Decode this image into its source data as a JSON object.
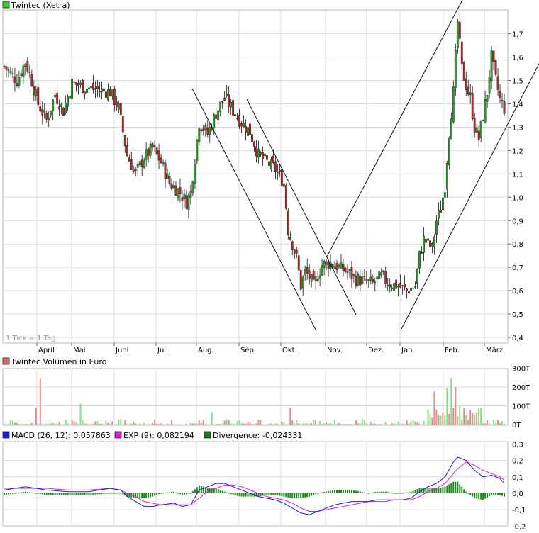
{
  "colors": {
    "up": "#2e9e2e",
    "down": "#b52a2a",
    "grid": "#dcdcdc",
    "axis": "#999999",
    "frame": "#bbbbbb",
    "macd": "#1b1bd6",
    "exp": "#d41fd4",
    "divergence": "#1a8a1a",
    "volume_up": "#84e084",
    "volume_down": "#e08a8a",
    "legend_price": "#36c836",
    "legend_volume": "#d46a6a",
    "legend_macd": "#1b1bd6",
    "legend_exp": "#d41fd4",
    "legend_div": "#1a7a1a"
  },
  "months": [
    "April",
    "Mai",
    "Juni",
    "Juli",
    "Aug.",
    "Sep.",
    "Okt.",
    "Nov.",
    "Dez.",
    "Jan.",
    "Feb.",
    "März"
  ],
  "price_panel": {
    "legend": "Twintec (Xetra)",
    "note": "1 Tick = 1 Tag",
    "y_ticks": [
      "0,4",
      "0,5",
      "0,6",
      "0,7",
      "0,8",
      "0,9",
      "1,0",
      "1,1",
      "1,2",
      "1,3",
      "1,4",
      "1,5",
      "1,6",
      "1,7"
    ]
  },
  "volume_panel": {
    "legend": "Twintec Volumen in Euro",
    "y_ticks": [
      "0T",
      "100T",
      "200T",
      "300T"
    ]
  },
  "macd_panel": {
    "legend_macd": "MACD (26, 12): 0,057863",
    "legend_exp": "EXP (9): 0,082194",
    "legend_div": "Divergence: -0,024331",
    "y_ticks": [
      "-0,2",
      "-0,1",
      "0,0",
      "0,1",
      "0,2",
      "0,3"
    ]
  },
  "chart_data": [
    {
      "type": "candlestick",
      "title": "Twintec (Xetra)",
      "x_unit": "trading days (1 Tick = 1 Tag)",
      "ylim": [
        0.4,
        1.8
      ],
      "grid": true,
      "trend_lines": [
        {
          "from": [
            "Juli end",
            1.46
          ],
          "to": [
            "Okt. end",
            0.43
          ]
        },
        {
          "from": [
            "Aug. end",
            1.42
          ],
          "to": [
            "Nov. end",
            0.5
          ]
        },
        {
          "from": [
            "Nov. start",
            0.73
          ],
          "to": [
            "Feb. end",
            1.82
          ]
        },
        {
          "from": [
            "Dez. end",
            0.44
          ],
          "to": [
            "März end",
            1.56
          ]
        }
      ],
      "close_path": [
        [
          0,
          1.56
        ],
        [
          6,
          1.5
        ],
        [
          10,
          1.58
        ],
        [
          12,
          1.53
        ],
        [
          16,
          1.4
        ],
        [
          20,
          1.33
        ],
        [
          24,
          1.44
        ],
        [
          28,
          1.37
        ],
        [
          32,
          1.49
        ],
        [
          38,
          1.47
        ],
        [
          44,
          1.46
        ],
        [
          50,
          1.45
        ],
        [
          54,
          1.38
        ],
        [
          58,
          1.18
        ],
        [
          62,
          1.1
        ],
        [
          66,
          1.17
        ],
        [
          70,
          1.21
        ],
        [
          74,
          1.15
        ],
        [
          78,
          1.06
        ],
        [
          82,
          1.03
        ],
        [
          86,
          0.98
        ],
        [
          88,
          1.02
        ],
        [
          92,
          1.32
        ],
        [
          96,
          1.27
        ],
        [
          100,
          1.36
        ],
        [
          104,
          1.43
        ],
        [
          108,
          1.37
        ],
        [
          112,
          1.32
        ],
        [
          116,
          1.28
        ],
        [
          120,
          1.18
        ],
        [
          124,
          1.15
        ],
        [
          128,
          1.12
        ],
        [
          132,
          1.06
        ],
        [
          134,
          0.86
        ],
        [
          138,
          0.74
        ],
        [
          140,
          0.62
        ],
        [
          142,
          0.68
        ],
        [
          144,
          0.66
        ],
        [
          146,
          0.62
        ],
        [
          150,
          0.71
        ],
        [
          154,
          0.72
        ],
        [
          158,
          0.7
        ],
        [
          162,
          0.68
        ],
        [
          166,
          0.65
        ],
        [
          170,
          0.64
        ],
        [
          174,
          0.63
        ],
        [
          178,
          0.66
        ],
        [
          182,
          0.63
        ],
        [
          186,
          0.62
        ],
        [
          190,
          0.6
        ],
        [
          194,
          0.62
        ],
        [
          196,
          0.75
        ],
        [
          198,
          0.82
        ],
        [
          200,
          0.8
        ],
        [
          202,
          0.78
        ],
        [
          204,
          0.9
        ],
        [
          206,
          0.95
        ],
        [
          208,
          1.05
        ],
        [
          210,
          1.28
        ],
        [
          212,
          1.45
        ],
        [
          214,
          1.75
        ],
        [
          216,
          1.55
        ],
        [
          218,
          1.48
        ],
        [
          220,
          1.42
        ],
        [
          222,
          1.3
        ],
        [
          224,
          1.25
        ],
        [
          226,
          1.35
        ],
        [
          228,
          1.45
        ],
        [
          230,
          1.6
        ],
        [
          232,
          1.5
        ],
        [
          234,
          1.42
        ],
        [
          236,
          1.38
        ]
      ]
    },
    {
      "type": "bar",
      "title": "Twintec Volumen in Euro",
      "ylim": [
        0,
        300
      ],
      "y_unit": "T",
      "notable_values": [
        {
          "x": 17,
          "value": 245
        },
        {
          "x": 15,
          "value": 90
        },
        {
          "x": 36,
          "value": 110
        },
        {
          "x": 135,
          "value": 90
        },
        {
          "x": 98,
          "value": 65
        },
        {
          "x": 203,
          "value": 175
        },
        {
          "x": 209,
          "value": 195
        },
        {
          "x": 211,
          "value": 245
        },
        {
          "x": 213,
          "value": 200
        },
        {
          "x": 215,
          "value": 100
        }
      ]
    },
    {
      "type": "line",
      "title": "MACD",
      "ylim": [
        -0.2,
        0.3
      ],
      "series": [
        {
          "name": "MACD (26, 12)",
          "values": [
            [
              0,
              0.02
            ],
            [
              10,
              0.04
            ],
            [
              20,
              0.02
            ],
            [
              30,
              0.01
            ],
            [
              40,
              0.01
            ],
            [
              50,
              0.03
            ],
            [
              55,
              0.02
            ],
            [
              58,
              -0.02
            ],
            [
              62,
              -0.05
            ],
            [
              66,
              -0.08
            ],
            [
              70,
              -0.08
            ],
            [
              74,
              -0.07
            ],
            [
              80,
              -0.06
            ],
            [
              84,
              -0.08
            ],
            [
              88,
              -0.07
            ],
            [
              92,
              0.02
            ],
            [
              96,
              0.04
            ],
            [
              100,
              0.06
            ],
            [
              104,
              0.06
            ],
            [
              108,
              0.04
            ],
            [
              112,
              0.02
            ],
            [
              116,
              0.0
            ],
            [
              120,
              -0.02
            ],
            [
              124,
              -0.03
            ],
            [
              128,
              -0.04
            ],
            [
              132,
              -0.06
            ],
            [
              136,
              -0.09
            ],
            [
              140,
              -0.12
            ],
            [
              144,
              -0.13
            ],
            [
              148,
              -0.11
            ],
            [
              152,
              -0.09
            ],
            [
              156,
              -0.07
            ],
            [
              160,
              -0.06
            ],
            [
              164,
              -0.05
            ],
            [
              168,
              -0.05
            ],
            [
              172,
              -0.05
            ],
            [
              176,
              -0.04
            ],
            [
              180,
              -0.04
            ],
            [
              184,
              -0.04
            ],
            [
              188,
              -0.04
            ],
            [
              192,
              -0.03
            ],
            [
              196,
              0.01
            ],
            [
              200,
              0.04
            ],
            [
              204,
              0.06
            ],
            [
              208,
              0.1
            ],
            [
              212,
              0.19
            ],
            [
              214,
              0.22
            ],
            [
              218,
              0.2
            ],
            [
              222,
              0.14
            ],
            [
              226,
              0.1
            ],
            [
              230,
              0.11
            ],
            [
              234,
              0.09
            ],
            [
              236,
              0.06
            ]
          ]
        },
        {
          "name": "EXP (9)",
          "values": [
            [
              0,
              0.03
            ],
            [
              10,
              0.03
            ],
            [
              20,
              0.03
            ],
            [
              30,
              0.02
            ],
            [
              40,
              0.02
            ],
            [
              50,
              0.03
            ],
            [
              55,
              0.02
            ],
            [
              58,
              0.0
            ],
            [
              62,
              -0.02
            ],
            [
              66,
              -0.05
            ],
            [
              70,
              -0.06
            ],
            [
              74,
              -0.07
            ],
            [
              80,
              -0.07
            ],
            [
              84,
              -0.07
            ],
            [
              88,
              -0.07
            ],
            [
              92,
              -0.03
            ],
            [
              96,
              0.01
            ],
            [
              100,
              0.03
            ],
            [
              104,
              0.05
            ],
            [
              108,
              0.05
            ],
            [
              112,
              0.04
            ],
            [
              116,
              0.02
            ],
            [
              120,
              0.0
            ],
            [
              124,
              -0.02
            ],
            [
              128,
              -0.03
            ],
            [
              132,
              -0.04
            ],
            [
              136,
              -0.06
            ],
            [
              140,
              -0.09
            ],
            [
              144,
              -0.11
            ],
            [
              148,
              -0.11
            ],
            [
              152,
              -0.1
            ],
            [
              156,
              -0.09
            ],
            [
              160,
              -0.08
            ],
            [
              164,
              -0.07
            ],
            [
              168,
              -0.06
            ],
            [
              172,
              -0.05
            ],
            [
              176,
              -0.05
            ],
            [
              180,
              -0.05
            ],
            [
              184,
              -0.04
            ],
            [
              188,
              -0.04
            ],
            [
              192,
              -0.04
            ],
            [
              196,
              -0.02
            ],
            [
              200,
              0.01
            ],
            [
              204,
              0.03
            ],
            [
              208,
              0.06
            ],
            [
              212,
              0.12
            ],
            [
              214,
              0.15
            ],
            [
              218,
              0.19
            ],
            [
              222,
              0.17
            ],
            [
              226,
              0.14
            ],
            [
              230,
              0.12
            ],
            [
              234,
              0.1
            ],
            [
              236,
              0.08
            ]
          ]
        }
      ]
    }
  ]
}
